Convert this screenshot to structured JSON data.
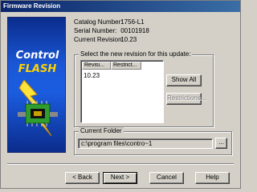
{
  "window": {
    "title": "Firmware Revision"
  },
  "banner": {
    "brand_line1": "Control",
    "brand_line2": "FLASH"
  },
  "info": {
    "catalog_label": "Catalog Number:",
    "catalog_value": "1756-L1",
    "serial_label": "Serial Number:",
    "serial_value": "00101918",
    "revision_label": "Current Revision:",
    "revision_value": "10.23"
  },
  "revision_group": {
    "title": "Select the new revision for this update:",
    "columns": [
      "Revisi...",
      "Restrict..."
    ],
    "rows": [
      "10.23"
    ],
    "show_all_label": "Show All",
    "restrictions_label": "Restrictions..."
  },
  "folder_group": {
    "title": "Current Folder",
    "value": "c:\\program files\\contro~1",
    "browse_label": "..."
  },
  "footer": {
    "back_label": "< Back",
    "next_label": "Next >",
    "cancel_label": "Cancel",
    "help_label": "Help"
  },
  "colors": {
    "title_bar": "#0a246a",
    "banner_blue": "#1b5de0",
    "brand_yellow": "#ffd400",
    "face": "#d4d0c8"
  },
  "icons": {
    "banner_art": "circuit-board-lightning-icon"
  }
}
